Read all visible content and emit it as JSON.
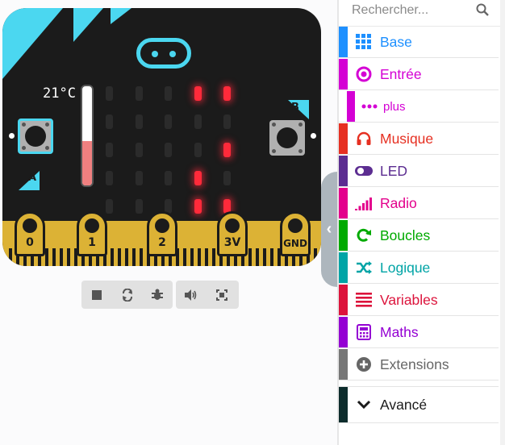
{
  "simulator": {
    "temperature": "21°C",
    "thermometer_level": 0.45,
    "button_a": "A",
    "button_b": "B",
    "pins": [
      "0",
      "1",
      "2",
      "3V",
      "GND"
    ],
    "led_matrix": [
      [
        0,
        0,
        0,
        1,
        1
      ],
      [
        0,
        0,
        0,
        0,
        0
      ],
      [
        0,
        0,
        0,
        0,
        1
      ],
      [
        0,
        0,
        0,
        1,
        0
      ],
      [
        0,
        0,
        0,
        1,
        1
      ]
    ],
    "controls": [
      "stop-icon",
      "restart-icon",
      "debug-icon",
      "sound-icon",
      "fullscreen-icon"
    ]
  },
  "toolbox": {
    "search_placeholder": "Rechercher...",
    "categories": [
      {
        "label": "Base",
        "color": "#1e90ff",
        "icon": "grid-icon"
      },
      {
        "label": "Entrée",
        "color": "#d400d4",
        "icon": "input-icon"
      },
      {
        "label": "plus",
        "color": "#d400d4",
        "icon": "more-icon"
      },
      {
        "label": "Musique",
        "color": "#e63022",
        "icon": "headphones-icon"
      },
      {
        "label": "LED",
        "color": "#5c2d91",
        "icon": "toggle-icon"
      },
      {
        "label": "Radio",
        "color": "#e3008c",
        "icon": "signal-icon"
      },
      {
        "label": "Boucles",
        "color": "#00aa00",
        "icon": "refresh-icon"
      },
      {
        "label": "Logique",
        "color": "#00a4a6",
        "icon": "shuffle-icon"
      },
      {
        "label": "Variables",
        "color": "#dc143c",
        "icon": "list-icon"
      },
      {
        "label": "Maths",
        "color": "#9400d3",
        "icon": "calculator-icon"
      },
      {
        "label": "Extensions",
        "color": "#777777",
        "icon": "plus-circle-icon"
      },
      {
        "label": "Avancé",
        "color": "#0d2c2c",
        "icon": "chevron-down-icon"
      }
    ]
  }
}
